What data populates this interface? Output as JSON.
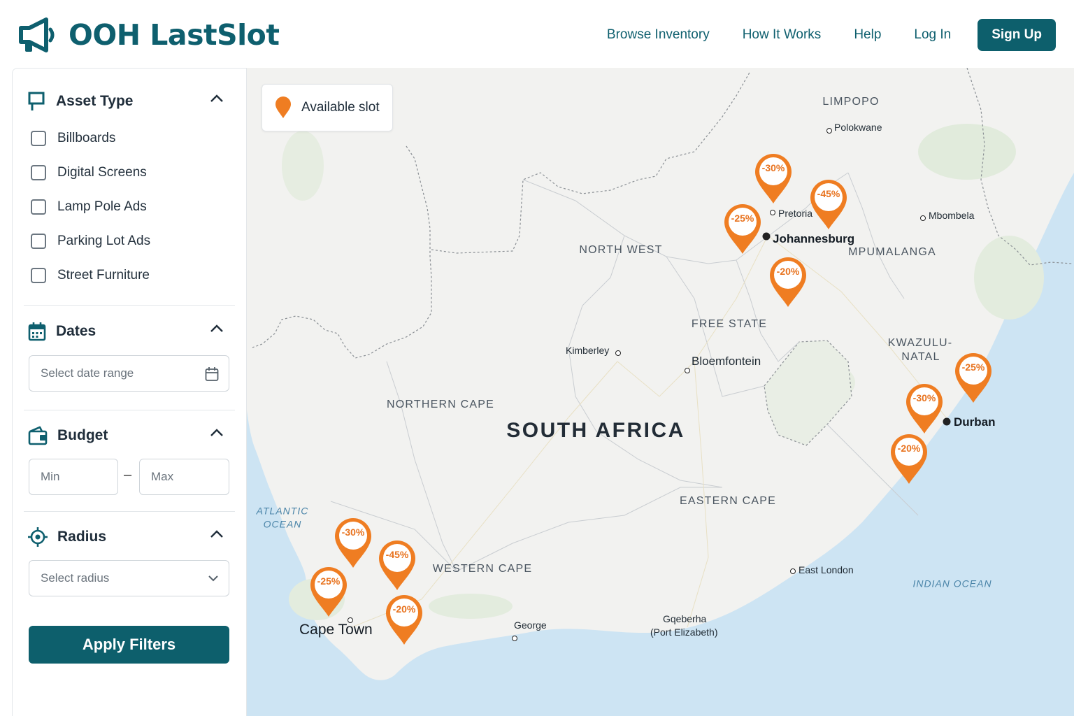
{
  "header": {
    "logo_text": "OOH LastSlot",
    "nav": {
      "browse": "Browse Inventory",
      "how": "How It Works",
      "help": "Help",
      "login": "Log In",
      "signup": "Sign Up"
    }
  },
  "sidebar": {
    "asset_type": {
      "title": "Asset Type",
      "options": [
        "Billboards",
        "Digital Screens",
        "Lamp Pole Ads",
        "Parking Lot Ads",
        "Street Furniture"
      ]
    },
    "dates": {
      "title": "Dates",
      "placeholder": "Select date range"
    },
    "budget": {
      "title": "Budget",
      "min_placeholder": "Min",
      "max_placeholder": "Max",
      "separator": "–"
    },
    "radius": {
      "title": "Radius",
      "placeholder": "Select radius"
    },
    "apply_label": "Apply Filters"
  },
  "map": {
    "legend_label": "Available slot",
    "country": "SOUTH AFRICA",
    "regions": {
      "limpopo": "LIMPOPO",
      "north_west": "NORTH WEST",
      "mpumalanga": "MPUMALANGA",
      "free_state": "FREE STATE",
      "kzn_1": "KWAZULU-",
      "kzn_2": "NATAL",
      "northern_cape": "NORTHERN CAPE",
      "eastern_cape": "EASTERN CAPE",
      "western_cape": "WESTERN CAPE"
    },
    "oceans": {
      "atlantic_1": "ATLANTIC",
      "atlantic_2": "OCEAN",
      "indian": "INDIAN OCEAN"
    },
    "cities": {
      "polokwane": "Polokwane",
      "pretoria": "Pretoria",
      "mbombela": "Mbombela",
      "johannesburg": "Johannesburg",
      "kimberley": "Kimberley",
      "bloemfontein": "Bloemfontein",
      "durban": "Durban",
      "east_london": "East London",
      "george": "George",
      "gqeberha_1": "Gqeberha",
      "gqeberha_2": "(Port Elizabeth)",
      "cape_town": "Cape Town"
    },
    "pins": {
      "jhb_north": "-30%",
      "jhb_east": "-45%",
      "jhb_west": "-25%",
      "jhb_south": "-20%",
      "durban_north": "-25%",
      "durban_mid": "-30%",
      "durban_south": "-20%",
      "cpt_north": "-30%",
      "cpt_east": "-45%",
      "cpt_west": "-25%",
      "cpt_south": "-20%"
    }
  }
}
